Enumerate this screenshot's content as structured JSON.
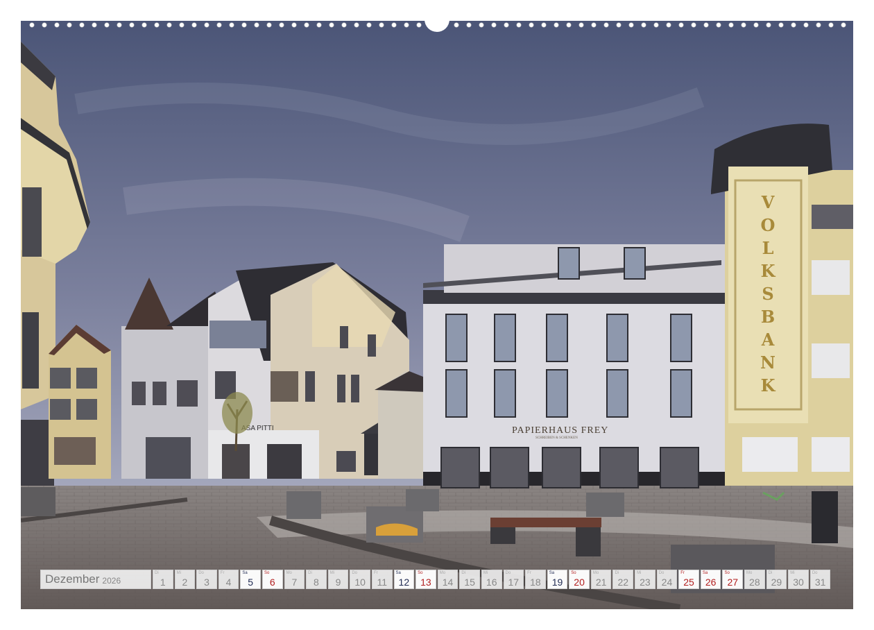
{
  "calendar": {
    "month": "Dezember",
    "year": "2026",
    "days": [
      {
        "wd": "Di",
        "d": "1",
        "type": "normal"
      },
      {
        "wd": "Mi",
        "d": "2",
        "type": "normal"
      },
      {
        "wd": "Do",
        "d": "3",
        "type": "normal"
      },
      {
        "wd": "Fr",
        "d": "4",
        "type": "normal"
      },
      {
        "wd": "Sa",
        "d": "5",
        "type": "sat"
      },
      {
        "wd": "So",
        "d": "6",
        "type": "sun"
      },
      {
        "wd": "Mo",
        "d": "7",
        "type": "normal"
      },
      {
        "wd": "Di",
        "d": "8",
        "type": "normal"
      },
      {
        "wd": "Mi",
        "d": "9",
        "type": "normal"
      },
      {
        "wd": "Do",
        "d": "10",
        "type": "normal"
      },
      {
        "wd": "Fr",
        "d": "11",
        "type": "normal"
      },
      {
        "wd": "Sa",
        "d": "12",
        "type": "sat"
      },
      {
        "wd": "So",
        "d": "13",
        "type": "sun"
      },
      {
        "wd": "Mo",
        "d": "14",
        "type": "normal"
      },
      {
        "wd": "Di",
        "d": "15",
        "type": "normal"
      },
      {
        "wd": "Mi",
        "d": "16",
        "type": "normal"
      },
      {
        "wd": "Do",
        "d": "17",
        "type": "normal"
      },
      {
        "wd": "Fr",
        "d": "18",
        "type": "normal"
      },
      {
        "wd": "Sa",
        "d": "19",
        "type": "sat"
      },
      {
        "wd": "So",
        "d": "20",
        "type": "sun"
      },
      {
        "wd": "Mo",
        "d": "21",
        "type": "normal"
      },
      {
        "wd": "Di",
        "d": "22",
        "type": "normal"
      },
      {
        "wd": "Mi",
        "d": "23",
        "type": "normal"
      },
      {
        "wd": "Do",
        "d": "24",
        "type": "normal"
      },
      {
        "wd": "Fr",
        "d": "25",
        "type": "hol"
      },
      {
        "wd": "Sa",
        "d": "26",
        "type": "hol"
      },
      {
        "wd": "So",
        "d": "27",
        "type": "hol"
      },
      {
        "wd": "Mo",
        "d": "28",
        "type": "normal"
      },
      {
        "wd": "Di",
        "d": "29",
        "type": "normal"
      },
      {
        "wd": "Mi",
        "d": "30",
        "type": "normal"
      },
      {
        "wd": "Do",
        "d": "31",
        "type": "normal"
      }
    ]
  },
  "photo": {
    "signs": {
      "volksbank": "VOLKSBANK",
      "papierhaus": "PAPIERHAUS FREY",
      "papierhaus_sub": "SCHREIBEN & SCHENKEN",
      "casa": "ASA PITTI"
    },
    "colors": {
      "sky_top": "#4d5778",
      "sky_bottom": "#9aa0b7",
      "pavement": "#7b7472",
      "white_building": "#dcdbe1",
      "yellow_building": "#e2d39f",
      "roof": "#34343a"
    }
  }
}
